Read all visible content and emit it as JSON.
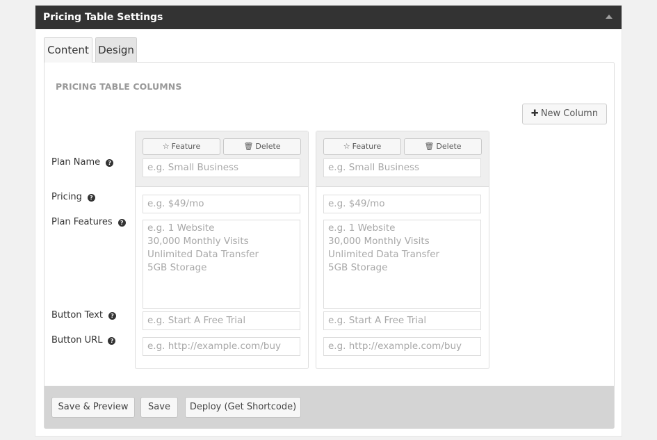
{
  "panel": {
    "title": "Pricing Table Settings",
    "collapse_icon": "triangle-up-icon"
  },
  "tabs": [
    {
      "label": "Content",
      "active": true
    },
    {
      "label": "Design",
      "active": false
    }
  ],
  "section_title": "PRICING TABLE COLUMNS",
  "new_column_button": {
    "icon": "plus-icon",
    "label": "New Column"
  },
  "row_labels": {
    "plan_name": "Plan Name",
    "pricing": "Pricing",
    "plan_features": "Plan Features",
    "button_text": "Button Text",
    "button_url": "Button URL",
    "help_icon": "question-circle-icon"
  },
  "columns": [
    {
      "feature_label": "Feature",
      "feature_icon": "star-outline-icon",
      "delete_label": "Delete",
      "delete_icon": "trash-icon",
      "plan_name": {
        "value": "",
        "placeholder": "e.g. Small Business"
      },
      "pricing": {
        "value": "",
        "placeholder": "e.g. $49/mo"
      },
      "features": {
        "value": "",
        "placeholder": "e.g. 1 Website\n30,000 Monthly Visits\nUnlimited Data Transfer\n5GB Storage"
      },
      "button_text": {
        "value": "",
        "placeholder": "e.g. Start A Free Trial"
      },
      "button_url": {
        "value": "",
        "placeholder": "e.g. http://example.com/buy"
      }
    },
    {
      "feature_label": "Feature",
      "feature_icon": "star-outline-icon",
      "delete_label": "Delete",
      "delete_icon": "trash-icon",
      "plan_name": {
        "value": "",
        "placeholder": "e.g. Small Business"
      },
      "pricing": {
        "value": "",
        "placeholder": "e.g. $49/mo"
      },
      "features": {
        "value": "",
        "placeholder": "e.g. 1 Website\n30,000 Monthly Visits\nUnlimited Data Transfer\n5GB Storage"
      },
      "button_text": {
        "value": "",
        "placeholder": "e.g. Start A Free Trial"
      },
      "button_url": {
        "value": "",
        "placeholder": "e.g. http://example.com/buy"
      }
    }
  ],
  "footer": {
    "save_preview_label": "Save & Preview",
    "save_label": "Save",
    "deploy_label": "Deploy (Get Shortcode)"
  },
  "glyphs": {
    "plus": "✚",
    "star": "☆",
    "trash": "🗑",
    "help": "?"
  }
}
